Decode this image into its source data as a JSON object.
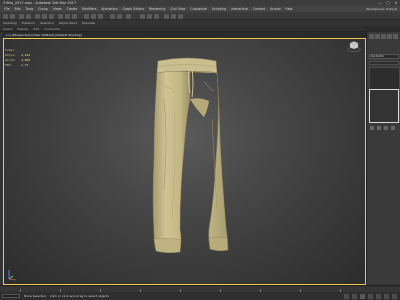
{
  "window": {
    "title": "3 files_2017.max - Autodesk 3ds Max 2017",
    "controls": [
      "—",
      "□",
      "✕"
    ]
  },
  "menu": {
    "items": [
      "File",
      "Edit",
      "Tools",
      "Group",
      "Views",
      "Create",
      "Modifiers",
      "Animation",
      "Graph Editors",
      "Rendering",
      "Civil View",
      "Customize",
      "Scripting",
      "Interactive",
      "Content",
      "Arnold",
      "Help"
    ],
    "workspace": "Workspaces: Default"
  },
  "ribbon": {
    "row1": [
      "Modeling",
      "Freeform",
      "Selection",
      "Object Paint",
      "Populate"
    ],
    "row2": [
      "Select",
      "Display",
      "Edit",
      "Customize"
    ]
  },
  "viewport": {
    "label": "[+] [Perspective] [User Defined] [Default Shading]",
    "stats": [
      {
        "key": "Total",
        "value": ""
      },
      {
        "key": "Polys:",
        "value": "4,444"
      },
      {
        "key": "Verts:",
        "value": "4,480"
      },
      {
        "key": "",
        "value": ""
      },
      {
        "key": "FPS:",
        "value": "1.73"
      }
    ],
    "border_color": "#f2c94c",
    "model_color": "#c8bd8c"
  },
  "command_panel": {
    "name_field": "Pants001",
    "tabs": [
      "create-icon",
      "modify-icon",
      "hierarchy-icon",
      "motion-icon",
      "display-icon",
      "utilities-icon"
    ]
  },
  "status": {
    "message": "Click or click-and-drag to select objects",
    "selection_info": "None Selected"
  }
}
